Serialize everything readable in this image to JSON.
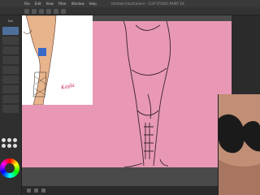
{
  "app": {
    "title": "Untitled (Illustration) - CLIP STUDIO PAINT EX"
  },
  "menu": {
    "items": [
      "File",
      "Edit",
      "View",
      "Filter",
      "Window",
      "Help"
    ]
  },
  "left_panel": {
    "label": "Tool"
  },
  "reference": {
    "signature": "Kayla"
  },
  "colors": {
    "canvas_pink": "#e898b4",
    "ui_dark": "#2b2b2b",
    "accent_blue": "#4e6f9a"
  },
  "icons": {
    "color_wheel": "color-wheel-icon",
    "webcam": "webcam-feed"
  }
}
